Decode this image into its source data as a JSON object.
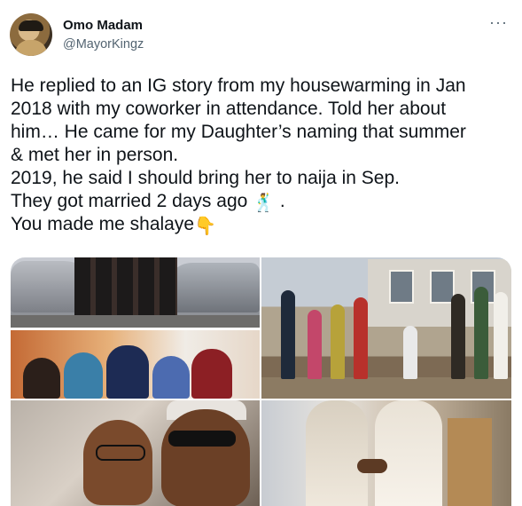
{
  "tweet": {
    "author": {
      "display_name": "Omo Madam",
      "handle": "@MayorKingz"
    },
    "more_icon": "more-options-icon",
    "text_lines": [
      "He replied to an IG story from my housewarming in Jan",
      "2018 with my coworker in attendance. Told her about",
      "him… He came for my Daughter’s naming that summer",
      "& met her in person.",
      "2019, he said I should bring her to naija in Sep.",
      "They got married 2 days ago",
      ".",
      "You made me shalaye"
    ],
    "emojis": {
      "dancer": "🕺",
      "point_down": "👇"
    },
    "media_count": 5
  }
}
